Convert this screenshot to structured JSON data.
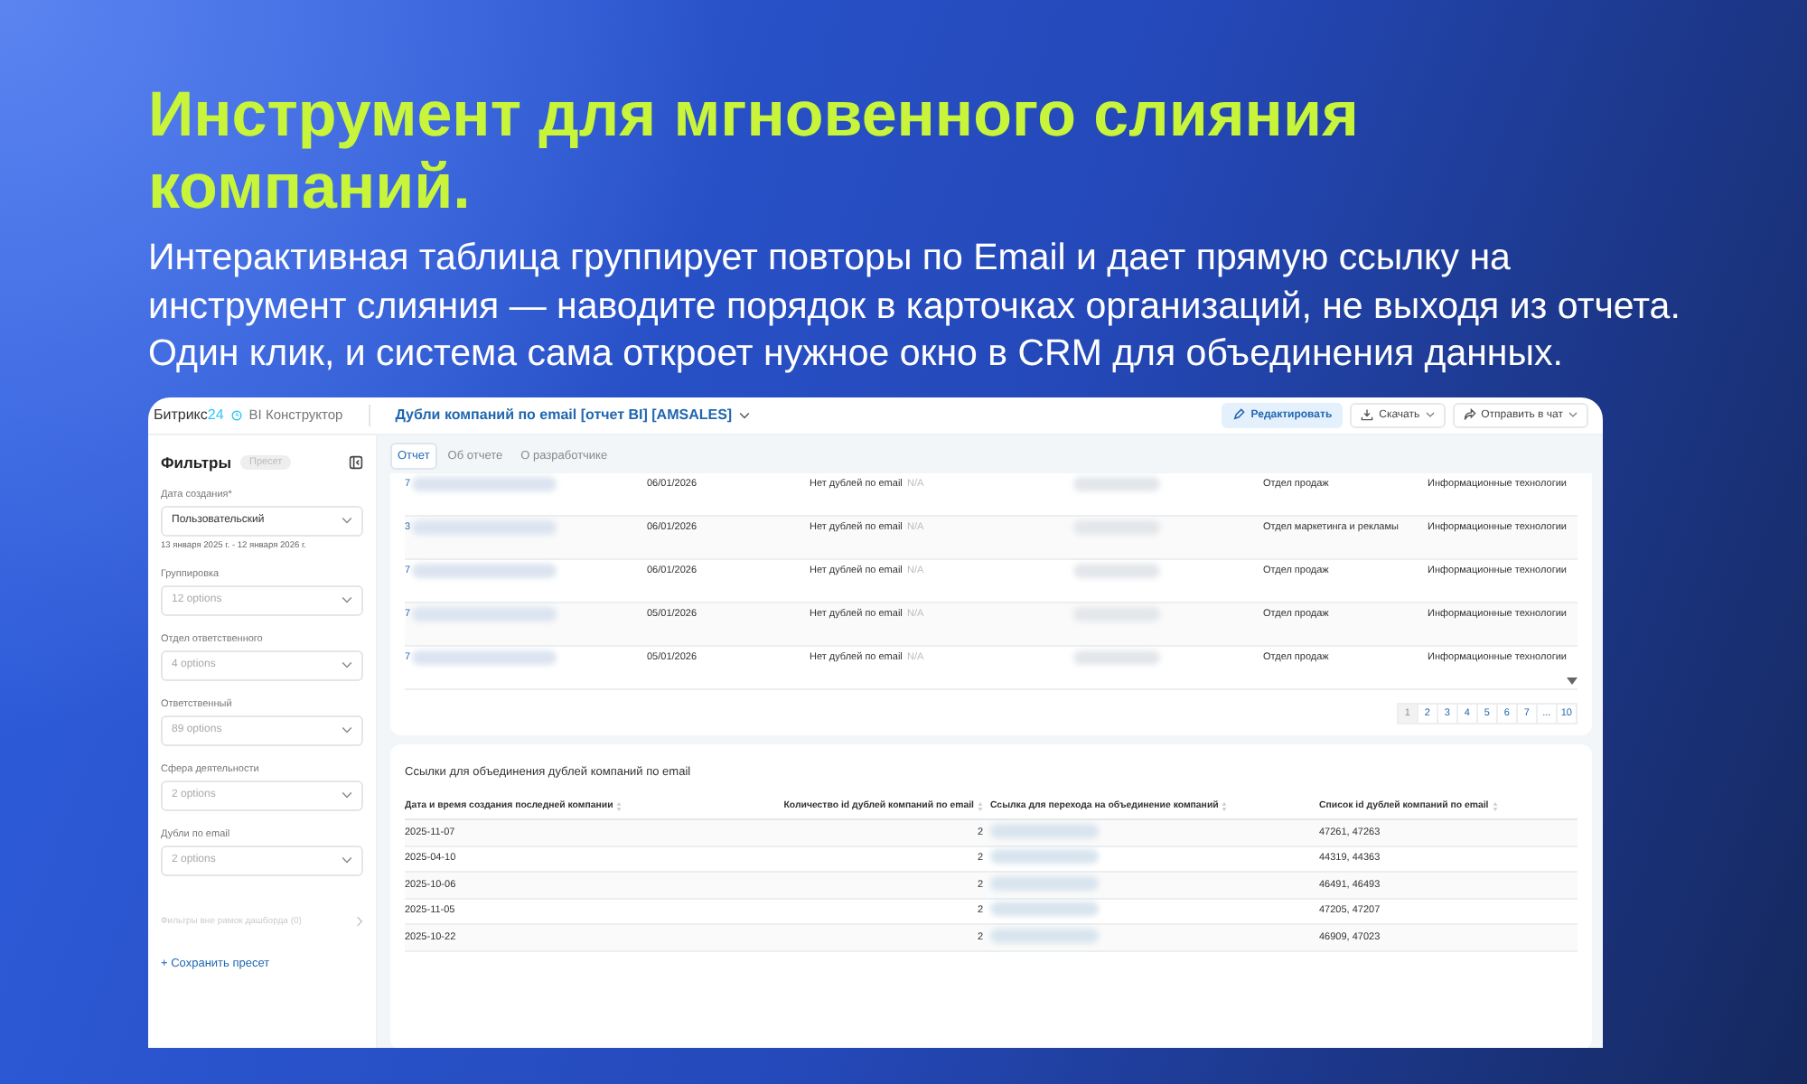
{
  "headline": "Инструмент для мгновенного слияния компаний.",
  "description": "Интерактивная таблица группирует повторы по Email и дает прямую ссылку на инструмент слияния — наводите порядок в карточках организаций, не выходя из отчета. Один клик, и система сама откроет нужное окно в CRM для объединения данных.",
  "app": {
    "logo": {
      "name": "Битрикс",
      "number": "24"
    },
    "product": "BI Конструктор",
    "report_title": "Дубли компаний по email [отчет BI] [AMSALES]",
    "actions": [
      {
        "label": "Редактировать",
        "kind": "primary"
      },
      {
        "label": "Скачать",
        "kind": "menu"
      },
      {
        "label": "Отправить в чат",
        "kind": "menu"
      }
    ],
    "filters": {
      "title": "Фильтры",
      "preset_badge": "Пресет",
      "items": [
        {
          "label": "Дата создания*",
          "value": "Пользовательский",
          "note": "13 января 2025 г. - 12 января 2026 г."
        },
        {
          "label": "Группировка",
          "placeholder": "12 options"
        },
        {
          "label": "Отдел ответственного",
          "placeholder": "4 options"
        },
        {
          "label": "Ответственный",
          "placeholder": "89 options"
        },
        {
          "label": "Сфера деятельности",
          "placeholder": "2 options"
        },
        {
          "label": "Дубли по email",
          "placeholder": "2 options"
        }
      ],
      "outside_filters": "Фильтры вне рамок дашборда (0)",
      "save_preset": "+ Сохранить пресет"
    },
    "tabs": [
      {
        "label": "Отчет",
        "selected": true
      },
      {
        "label": "Об отчете",
        "selected": false
      },
      {
        "label": "О разработчике",
        "selected": false
      }
    ],
    "table1": {
      "rows": [
        {
          "id": "7",
          "date": "06/01/2026",
          "duplicates": "Нет дублей по email",
          "value": "N/A",
          "department": "Отдел продаж",
          "sphere": "Информационные технологии"
        },
        {
          "id": "3",
          "date": "06/01/2026",
          "duplicates": "Нет дублей по email",
          "value": "N/A",
          "department": "Отдел маркетинга и рекламы",
          "sphere": "Информационные технологии"
        },
        {
          "id": "7",
          "date": "06/01/2026",
          "duplicates": "Нет дублей по email",
          "value": "N/A",
          "department": "Отдел продаж",
          "sphere": "Информационные технологии"
        },
        {
          "id": "7",
          "date": "05/01/2026",
          "duplicates": "Нет дублей по email",
          "value": "N/A",
          "department": "Отдел продаж",
          "sphere": "Информационные технологии"
        },
        {
          "id": "7",
          "date": "05/01/2026",
          "duplicates": "Нет дублей по email",
          "value": "N/A",
          "department": "Отдел продаж",
          "sphere": "Информационные технологии"
        }
      ],
      "pages": [
        {
          "label": "1",
          "selected": true
        },
        {
          "label": "2",
          "selected": false
        },
        {
          "label": "3",
          "selected": false
        },
        {
          "label": "4",
          "selected": false
        },
        {
          "label": "5",
          "selected": false
        },
        {
          "label": "6",
          "selected": false
        },
        {
          "label": "7",
          "selected": false
        },
        {
          "label": "...",
          "selected": false
        },
        {
          "label": "10",
          "selected": false
        }
      ]
    },
    "table2": {
      "title": "Ссылки для объединения дублей компаний по email",
      "columns": [
        "Дата и время создания последней компании",
        "Количество id дублей компаний по email",
        "Ссылка для перехода на объединение компаний",
        "Список id дублей компаний по email"
      ],
      "rows": [
        [
          "2025-11-07",
          "2",
          "47261, 47263"
        ],
        [
          "2025-04-10",
          "2",
          "44319, 44363"
        ],
        [
          "2025-10-06",
          "2",
          "46491, 46493"
        ],
        [
          "2025-11-05",
          "2",
          "47205, 47207"
        ],
        [
          "2025-10-22",
          "2",
          "46909, 47023"
        ]
      ]
    }
  }
}
